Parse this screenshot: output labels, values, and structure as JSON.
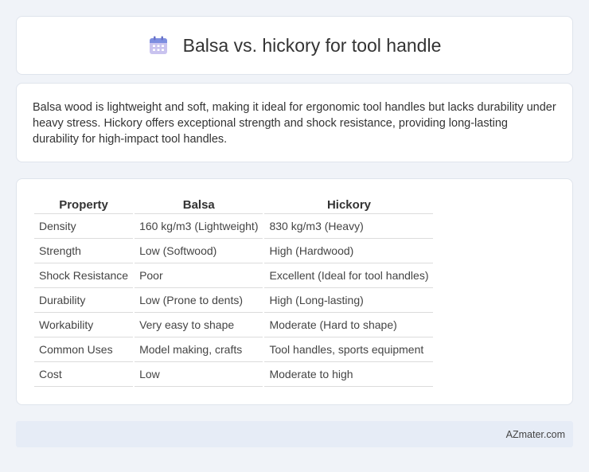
{
  "header": {
    "title": "Balsa vs. hickory for tool handle",
    "icon": "calendar-icon"
  },
  "description": "Balsa wood is lightweight and soft, making it ideal for ergonomic tool handles but lacks durability under heavy stress. Hickory offers exceptional strength and shock resistance, providing long-lasting durability for high-impact tool handles.",
  "table": {
    "headers": [
      "Property",
      "Balsa",
      "Hickory"
    ],
    "rows": [
      [
        "Density",
        "160 kg/m3 (Lightweight)",
        "830 kg/m3 (Heavy)"
      ],
      [
        "Strength",
        "Low (Softwood)",
        "High (Hardwood)"
      ],
      [
        "Shock Resistance",
        "Poor",
        "Excellent (Ideal for tool handles)"
      ],
      [
        "Durability",
        "Low (Prone to dents)",
        "High (Long-lasting)"
      ],
      [
        "Workability",
        "Very easy to shape",
        "Moderate (Hard to shape)"
      ],
      [
        "Common Uses",
        "Model making, crafts",
        "Tool handles, sports equipment"
      ],
      [
        "Cost",
        "Low",
        "Moderate to high"
      ]
    ]
  },
  "footer": {
    "brand": "AZmater.com"
  }
}
